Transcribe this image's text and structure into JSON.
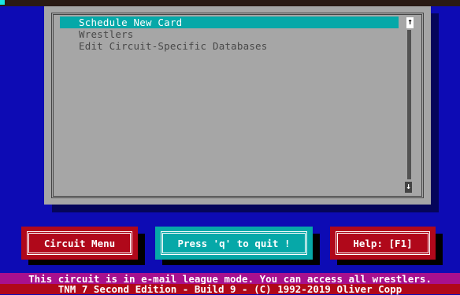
{
  "menu": {
    "items": [
      {
        "label": "Schedule New Card",
        "selected": true
      },
      {
        "label": "Wrestlers",
        "selected": false
      },
      {
        "label": "Edit Circuit-Specific Databases",
        "selected": false
      }
    ],
    "scroll_up_glyph": "↑",
    "scroll_down_glyph": "↓"
  },
  "buttons": {
    "circuit_menu": "Circuit Menu",
    "quit": "Press 'q' to quit !",
    "help": "Help: [F1]"
  },
  "status": {
    "line1": "This circuit is in e-mail league mode. You can access all wrestlers.",
    "line2": "TNM 7 Second Edition - Build 9 - (C) 1992-2019 Oliver Copp"
  },
  "colors": {
    "background": "#0d0bb4",
    "window": "#a6a6a6",
    "selection": "#06a8a8",
    "button_red": "#b0081a",
    "button_cyan": "#06a8a8",
    "status_magenta": "#a8108e",
    "status_red": "#b0081a"
  }
}
